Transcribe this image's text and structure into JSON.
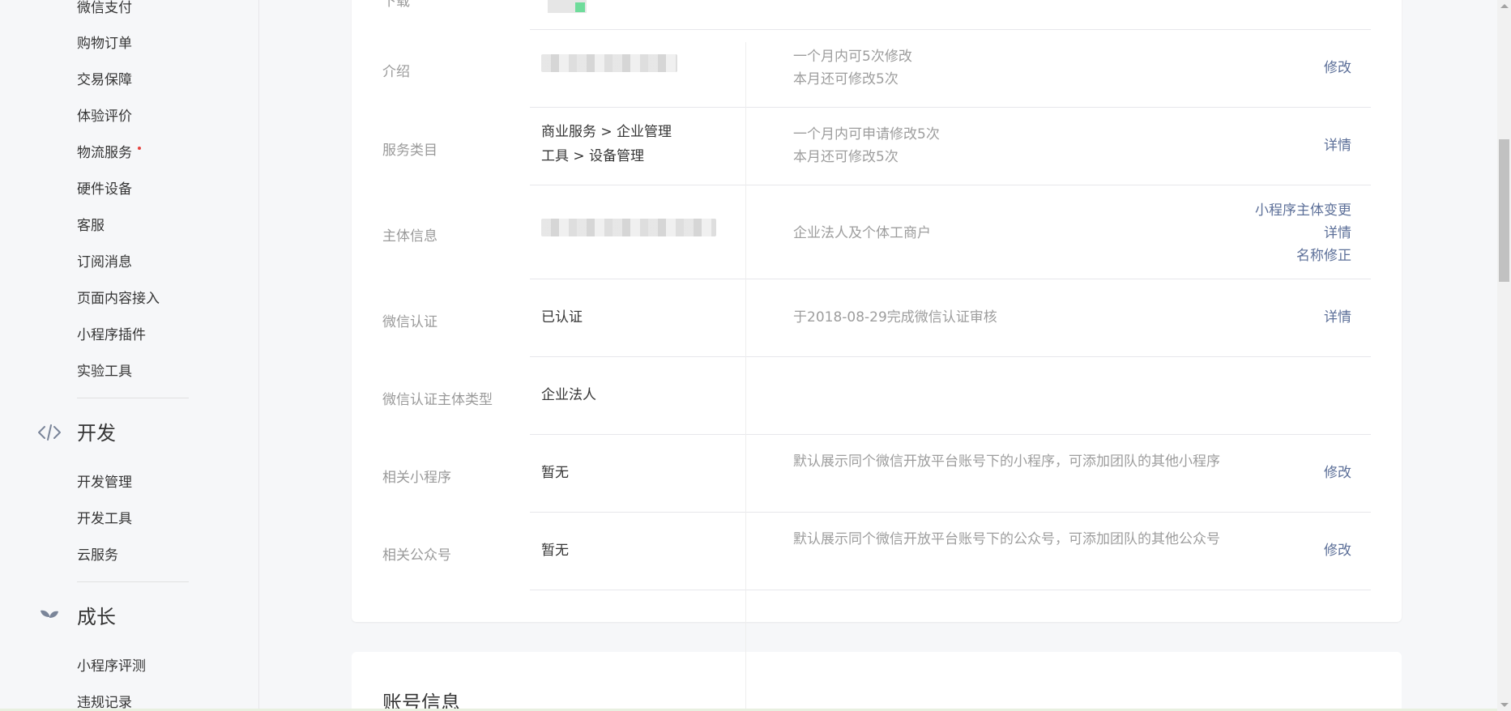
{
  "sidebar": {
    "items_top": [
      "微信支付",
      "购物订单",
      "交易保障",
      "体验评价",
      "物流服务",
      "硬件设备",
      "客服",
      "订阅消息",
      "页面内容接入",
      "小程序插件",
      "实验工具"
    ],
    "dev_group": {
      "title": "开发",
      "icon": "code-icon",
      "items": [
        "开发管理",
        "开发工具",
        "云服务"
      ]
    },
    "growth_group": {
      "title": "成长",
      "icon": "sprout-icon",
      "items": [
        "小程序评测",
        "违规记录"
      ]
    }
  },
  "info": {
    "rows": [
      {
        "label": "下载"
      },
      {
        "label": "介绍",
        "value": "",
        "desc": [
          "一个月内可5次修改",
          "本月还可修改5次"
        ],
        "actions": [
          "修改"
        ]
      },
      {
        "label": "服务类目",
        "value": [
          "商业服务 > 企业管理",
          "工具 > 设备管理"
        ],
        "desc": [
          "一个月内可申请修改5次",
          "本月还可修改5次"
        ],
        "actions": [
          "详情"
        ]
      },
      {
        "label": "主体信息",
        "value": "",
        "desc": [
          "企业法人及个体工商户"
        ],
        "actions": [
          "小程序主体变更",
          "详情",
          "名称修正"
        ]
      },
      {
        "label": "微信认证",
        "value": "已认证",
        "desc": [
          "于2018-08-29完成微信认证审核"
        ],
        "actions": [
          "详情"
        ]
      },
      {
        "label": "微信认证主体类型",
        "value": "企业法人"
      },
      {
        "label": "相关小程序",
        "value": "暂无",
        "desc": [
          "默认展示同个微信开放平台账号下的小程序，可添加团队的其他小程序"
        ],
        "actions": [
          "修改"
        ]
      },
      {
        "label": "相关公众号",
        "value": "暂无",
        "desc": [
          "默认展示同个微信开放平台账号下的公众号，可添加团队的其他公众号"
        ],
        "actions": [
          "修改"
        ]
      }
    ]
  },
  "account_section": {
    "title": "账号信息"
  },
  "colors": {
    "link": "#576b95",
    "label": "#9a9a9a",
    "text": "#353535",
    "background": "#f6f7f9",
    "badge": "#e64340"
  }
}
